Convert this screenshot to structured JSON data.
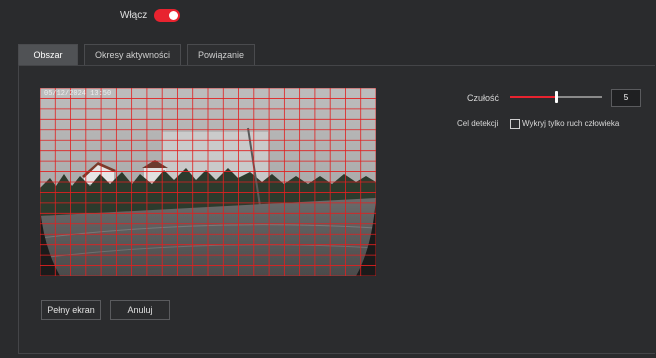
{
  "header": {
    "enable_label": "Włącz",
    "enable_on": true
  },
  "tabs": [
    {
      "label": "Obszar",
      "active": true
    },
    {
      "label": "Okresy aktywności",
      "active": false
    },
    {
      "label": "Powiązanie",
      "active": false
    }
  ],
  "video": {
    "timestamp": "05/12/2024 13:50"
  },
  "sensitivity": {
    "label": "Czułość",
    "value": "5",
    "level_fraction": 0.5
  },
  "detection_target": {
    "label": "Cel detekcji",
    "option_label": "Wykryj tylko ruch człowieka",
    "checked": false
  },
  "buttons": {
    "fullscreen": "Pełny ekran",
    "cancel": "Anuluj"
  },
  "colors": {
    "accent": "#e8232f",
    "grid": "#e02020"
  }
}
